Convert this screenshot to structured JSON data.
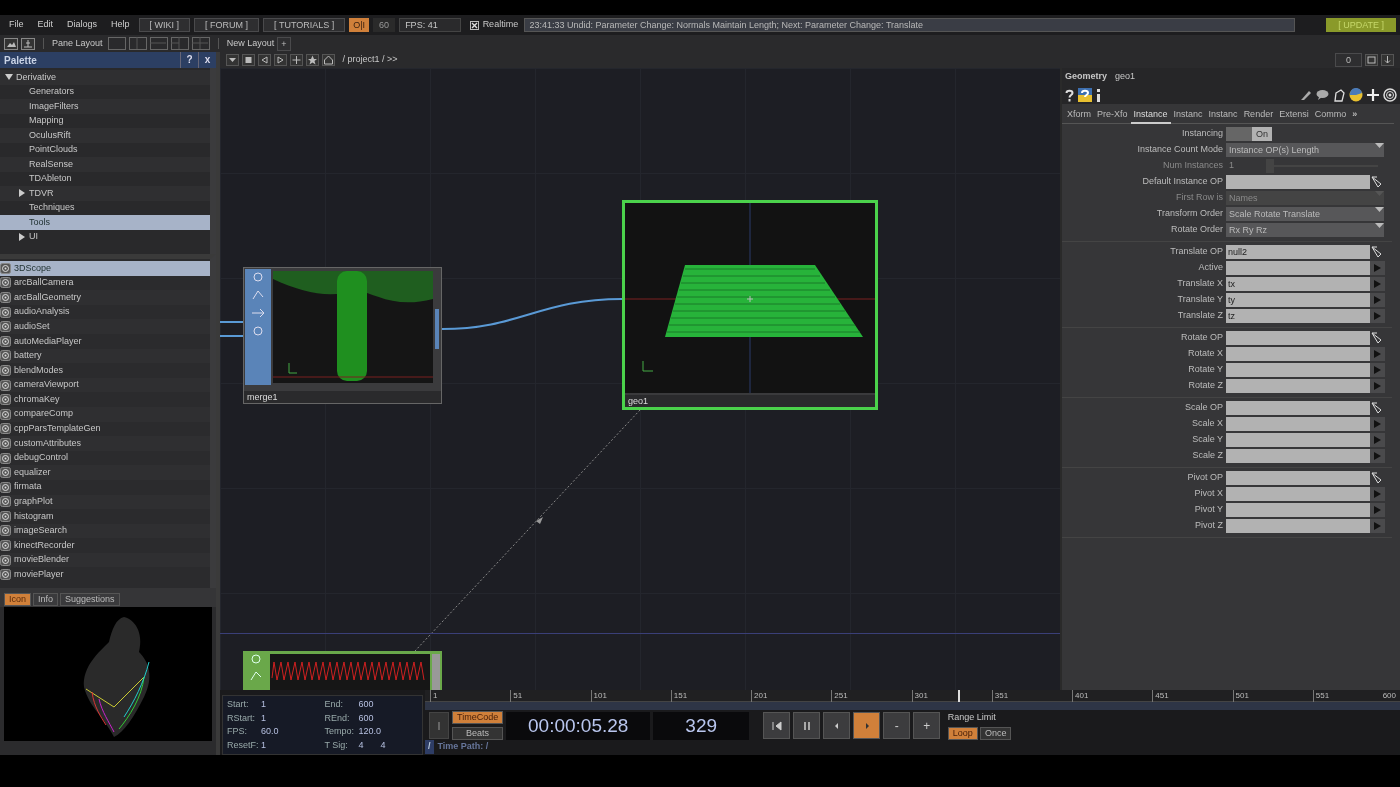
{
  "menu": [
    "File",
    "Edit",
    "Dialogs",
    "Help"
  ],
  "links": [
    "[ WIKI ]",
    "[ FORUM ]",
    "[ TUTORIALS ]"
  ],
  "perform": {
    "label": "O|I",
    "on": true
  },
  "fps_cap": "60",
  "fps": "FPS: 41",
  "realtime": {
    "label": "Realtime",
    "checked": true
  },
  "status": "23:41:33 Undid: Parameter Change: Normals Maintain Length; Next: Parameter Change: Translate",
  "update": "[ UPDATE ]",
  "toolbar": {
    "pane_layout": "Pane Layout",
    "new_layout": "New Layout",
    "add": "+"
  },
  "palette": {
    "title": "Palette",
    "help": "?",
    "close": "x",
    "tree": [
      {
        "label": "Derivative",
        "expanded": true,
        "selected": false,
        "children": [
          {
            "label": "Generators",
            "selected": false
          },
          {
            "label": "ImageFilters",
            "selected": false
          },
          {
            "label": "Mapping",
            "selected": false
          },
          {
            "label": "OculusRift",
            "selected": false
          },
          {
            "label": "PointClouds",
            "selected": false
          },
          {
            "label": "RealSense",
            "selected": false
          },
          {
            "label": "TDAbleton",
            "selected": false
          },
          {
            "label": "TDVR",
            "selected": false,
            "expanded": false
          },
          {
            "label": "Techniques",
            "selected": false
          },
          {
            "label": "Tools",
            "selected": true
          },
          {
            "label": "UI",
            "selected": false,
            "expanded": false
          }
        ]
      }
    ],
    "components": [
      {
        "label": "3DScope",
        "selected": true
      },
      {
        "label": "arcBallCamera",
        "selected": false
      },
      {
        "label": "arcBallGeometry",
        "selected": false
      },
      {
        "label": "audioAnalysis",
        "selected": false
      },
      {
        "label": "audioSet",
        "selected": false
      },
      {
        "label": "autoMediaPlayer",
        "selected": false
      },
      {
        "label": "battery",
        "selected": false
      },
      {
        "label": "blendModes",
        "selected": false
      },
      {
        "label": "cameraViewport",
        "selected": false
      },
      {
        "label": "chromaKey",
        "selected": false
      },
      {
        "label": "compareComp",
        "selected": false
      },
      {
        "label": "cppParsTemplateGen",
        "selected": false
      },
      {
        "label": "customAttributes",
        "selected": false
      },
      {
        "label": "debugControl",
        "selected": false
      },
      {
        "label": "equalizer",
        "selected": false
      },
      {
        "label": "firmata",
        "selected": false
      },
      {
        "label": "graphPlot",
        "selected": false
      },
      {
        "label": "histogram",
        "selected": false
      },
      {
        "label": "imageSearch",
        "selected": false
      },
      {
        "label": "kinectRecorder",
        "selected": false
      },
      {
        "label": "movieBlender",
        "selected": false
      },
      {
        "label": "moviePlayer",
        "selected": false
      }
    ],
    "tabs": [
      {
        "label": "Icon",
        "selected": true
      },
      {
        "label": "Info",
        "selected": false
      },
      {
        "label": "Suggestions",
        "selected": false
      }
    ]
  },
  "path": "/ project1 / >>",
  "path_count": "0",
  "nodes": [
    {
      "kind": "panel",
      "name": "merge1",
      "selected": false
    },
    {
      "kind": "geometry",
      "name": "geo1",
      "selected": true
    },
    {
      "kind": "chop"
    }
  ],
  "parameters": {
    "type": "Geometry",
    "name": "geo1",
    "tabs": [
      {
        "label": "Xform",
        "selected": false
      },
      {
        "label": "Pre-Xfo",
        "selected": false
      },
      {
        "label": "Instance",
        "selected": true
      },
      {
        "label": "Instanc",
        "selected": false
      },
      {
        "label": "Instanc",
        "selected": false
      },
      {
        "label": "Render",
        "selected": false
      },
      {
        "label": "Extensi",
        "selected": false
      },
      {
        "label": "Commo",
        "selected": false
      }
    ],
    "more": "»",
    "groups": [
      [
        {
          "label": "Instancing",
          "kind": "toggle",
          "value": "On",
          "disabled": false
        },
        {
          "label": "Instance Count Mode",
          "kind": "menu",
          "value": "Instance OP(s) Length",
          "disabled": false
        },
        {
          "label": "Num Instances",
          "kind": "slider",
          "value": "1",
          "disabled": true
        },
        {
          "label": "Default Instance OP",
          "kind": "op",
          "disabled": false
        },
        {
          "label": "First Row is",
          "kind": "menu",
          "value": "Names",
          "disabled": true
        },
        {
          "label": "Transform Order",
          "kind": "menu",
          "value": "Scale Rotate Translate",
          "disabled": false
        },
        {
          "label": "Rotate Order",
          "kind": "menu",
          "value": "Rx Ry Rz",
          "disabled": false
        }
      ],
      [
        {
          "label": "Translate OP",
          "kind": "op",
          "value": "null2",
          "disabled": false
        },
        {
          "label": "Active",
          "kind": "field",
          "disabled": false
        },
        {
          "label": "Translate X",
          "kind": "field",
          "value": "tx",
          "disabled": false
        },
        {
          "label": "Translate Y",
          "kind": "field",
          "value": "ty",
          "disabled": false
        },
        {
          "label": "Translate Z",
          "kind": "field",
          "value": "tz",
          "disabled": false
        }
      ],
      [
        {
          "label": "Rotate OP",
          "kind": "op",
          "disabled": false
        },
        {
          "label": "Rotate X",
          "kind": "field",
          "disabled": false
        },
        {
          "label": "Rotate Y",
          "kind": "field",
          "disabled": false
        },
        {
          "label": "Rotate Z",
          "kind": "field",
          "disabled": false
        }
      ],
      [
        {
          "label": "Scale OP",
          "kind": "op",
          "disabled": false
        },
        {
          "label": "Scale X",
          "kind": "field",
          "disabled": false
        },
        {
          "label": "Scale Y",
          "kind": "field",
          "disabled": false
        },
        {
          "label": "Scale Z",
          "kind": "field",
          "disabled": false
        }
      ],
      [
        {
          "label": "Pivot OP",
          "kind": "op",
          "disabled": false
        },
        {
          "label": "Pivot X",
          "kind": "field",
          "disabled": false
        },
        {
          "label": "Pivot Y",
          "kind": "field",
          "disabled": false
        },
        {
          "label": "Pivot Z",
          "kind": "field",
          "disabled": false
        }
      ]
    ]
  },
  "timeline": {
    "info": [
      {
        "label": "Start:",
        "values": [
          "1"
        ]
      },
      {
        "label": "End:",
        "values": [
          "600"
        ]
      },
      {
        "label": "RStart:",
        "values": [
          "1"
        ]
      },
      {
        "label": "REnd:",
        "values": [
          "600"
        ]
      },
      {
        "label": "FPS:",
        "values": [
          "60.0"
        ]
      },
      {
        "label": "Tempo:",
        "values": [
          "120.0"
        ]
      },
      {
        "label": "ResetF:",
        "values": [
          "1"
        ]
      },
      {
        "label": "T Sig:",
        "values": [
          "4",
          "4"
        ]
      }
    ],
    "ruler": [
      "1",
      "51",
      "101",
      "151",
      "201",
      "251",
      "301",
      "351",
      "401",
      "451",
      "501",
      "551",
      "600"
    ],
    "playhead": {
      "level": 0.548
    },
    "modes": [
      {
        "label": "TimeCode",
        "selected": true
      },
      {
        "label": "Beats",
        "selected": false
      }
    ],
    "timecode": "00:00:05.28",
    "frame": "329",
    "transport": [
      {
        "kind": "rewind",
        "active": false
      },
      {
        "kind": "pause",
        "active": false
      },
      {
        "kind": "back",
        "active": false
      },
      {
        "kind": "play",
        "active": true
      },
      {
        "kind": "text",
        "label": "-",
        "active": false
      },
      {
        "kind": "text",
        "label": "+",
        "active": false
      }
    ],
    "range_label": "Range Limit",
    "range_modes": [
      {
        "label": "Loop",
        "selected": true
      },
      {
        "label": "Once",
        "selected": false
      }
    ],
    "path_button": "/",
    "time_path": "Time Path: /"
  }
}
